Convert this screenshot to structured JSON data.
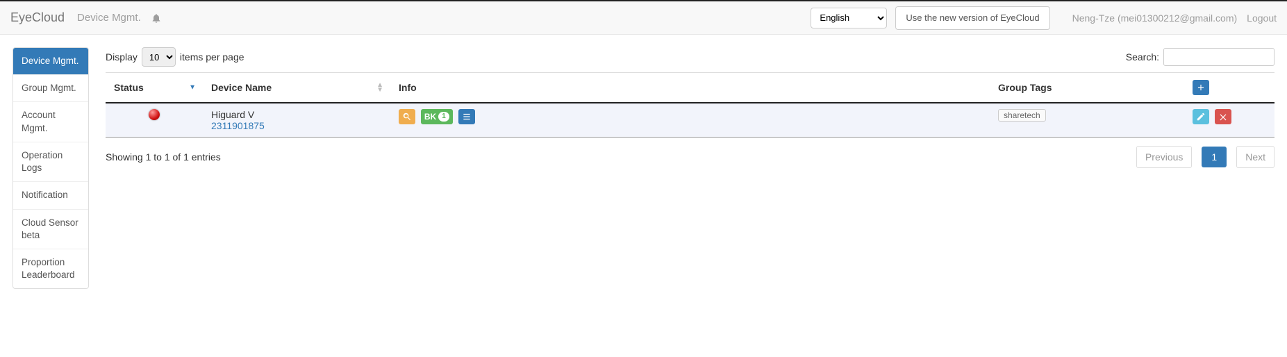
{
  "header": {
    "brand": "EyeCloud",
    "crumb": "Device Mgmt.",
    "language_selected": "English",
    "promo_button": "Use the new version of EyeCloud",
    "user_label": "Neng-Tze (mei01300212@gmail.com)",
    "logout": "Logout"
  },
  "sidebar": {
    "items": [
      {
        "label": "Device Mgmt.",
        "active": true
      },
      {
        "label": "Group Mgmt."
      },
      {
        "label": "Account Mgmt."
      },
      {
        "label": "Operation Logs"
      },
      {
        "label": "Notification"
      },
      {
        "label": "Cloud Sensor beta"
      },
      {
        "label": "Proportion Leaderboard"
      }
    ]
  },
  "toolbar": {
    "display_prefix": "Display",
    "display_suffix": "items per page",
    "page_size": "10",
    "search_label": "Search:"
  },
  "table": {
    "columns": {
      "status": "Status",
      "name": "Device Name",
      "info": "Info",
      "tags": "Group Tags"
    },
    "rows": [
      {
        "status": "offline",
        "device_name": "Higuard V",
        "device_id": "2311901875",
        "bk_label": "BK",
        "bk_count": "1",
        "tags": [
          "sharetech"
        ]
      }
    ]
  },
  "footer": {
    "showing": "Showing 1 to 1 of 1 entries",
    "previous": "Previous",
    "page": "1",
    "next": "Next"
  }
}
